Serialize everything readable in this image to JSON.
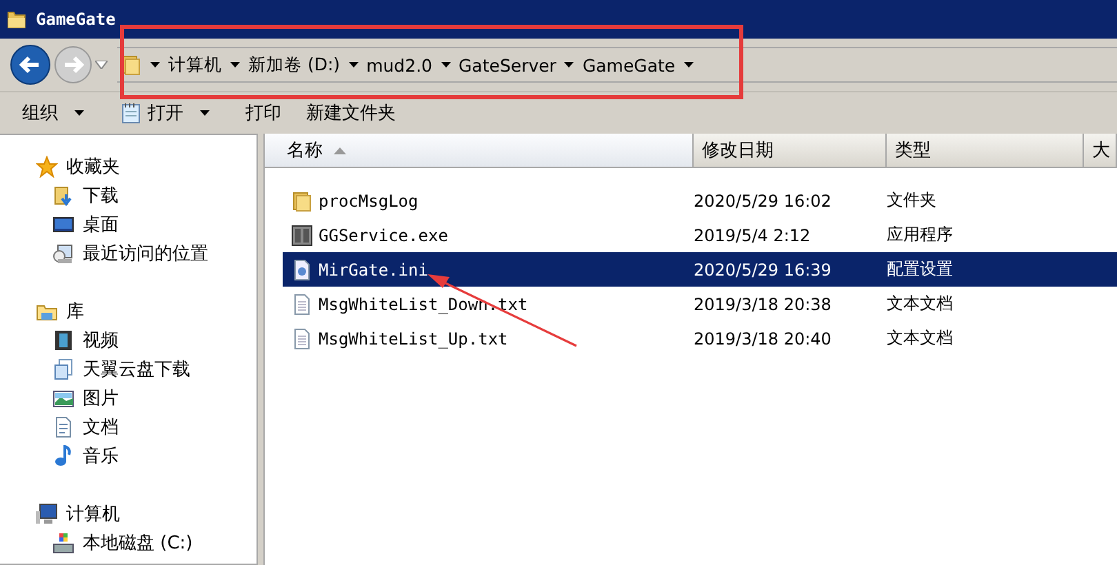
{
  "window": {
    "title": "GameGate"
  },
  "address_bar": {
    "segments": [
      "计算机",
      "新加卷 (D:)",
      "mud2.0",
      "GateServer",
      "GameGate"
    ]
  },
  "toolbar": [
    {
      "label": "组织",
      "kind": "plain",
      "dropdown": true
    },
    {
      "label": "打开",
      "kind": "notepad",
      "dropdown": true
    },
    {
      "label": "打印",
      "kind": "plain",
      "dropdown": false
    },
    {
      "label": "新建文件夹",
      "kind": "plain",
      "dropdown": false
    }
  ],
  "sidebar": {
    "groups": [
      {
        "label": "收藏夹",
        "kind": "star",
        "children": [
          {
            "label": "下载",
            "kind": "download",
            "selected": false
          },
          {
            "label": "桌面",
            "kind": "desktop",
            "selected": false
          },
          {
            "label": "最近访问的位置",
            "kind": "recent",
            "selected": false
          }
        ]
      },
      {
        "label": "库",
        "kind": "library",
        "children": [
          {
            "label": "视频",
            "kind": "video",
            "selected": false
          },
          {
            "label": "天翼云盘下载",
            "kind": "cloud",
            "selected": false
          },
          {
            "label": "图片",
            "kind": "pictures",
            "selected": false
          },
          {
            "label": "文档",
            "kind": "documents",
            "selected": false
          },
          {
            "label": "音乐",
            "kind": "music",
            "selected": false
          }
        ]
      },
      {
        "label": "计算机",
        "kind": "computer",
        "children": [
          {
            "label": "本地磁盘 (C:)",
            "kind": "disk",
            "selected": false
          }
        ]
      }
    ]
  },
  "table": {
    "columns": [
      {
        "label": "名称",
        "sorted": true
      },
      {
        "label": "修改日期",
        "sorted": false
      },
      {
        "label": "类型",
        "sorted": false
      },
      {
        "label": "大",
        "sorted": false
      }
    ],
    "rows": [
      {
        "name": "procMsgLog",
        "modified": "2020/5/29 16:02",
        "type": "文件夹",
        "kind": "folder",
        "selected": false
      },
      {
        "name": "GGService.exe",
        "modified": "2019/5/4 2:12",
        "type": "应用程序",
        "kind": "exe",
        "selected": false
      },
      {
        "name": "MirGate.ini",
        "modified": "2020/5/29 16:39",
        "type": "配置设置",
        "kind": "ini",
        "selected": true
      },
      {
        "name": "MsgWhiteList_Down.txt",
        "modified": "2019/3/18 20:38",
        "type": "文本文档",
        "kind": "txt",
        "selected": false
      },
      {
        "name": "MsgWhiteList_Up.txt",
        "modified": "2019/3/18 20:40",
        "type": "文本文档",
        "kind": "txt",
        "selected": false
      }
    ]
  }
}
